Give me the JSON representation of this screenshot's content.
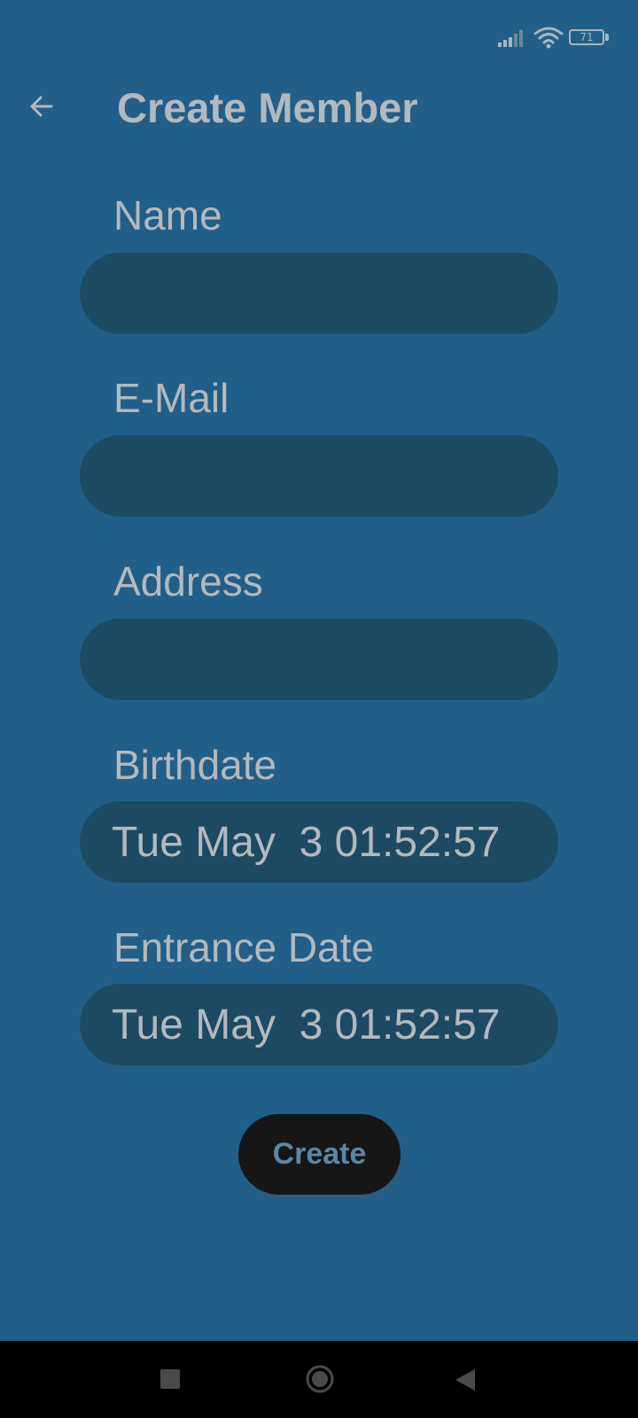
{
  "status_bar": {
    "battery_level": "71",
    "icons": [
      "signal-icon",
      "wifi-icon",
      "battery-icon"
    ]
  },
  "app_bar": {
    "title": "Create Member",
    "back_icon": "arrow-back-icon"
  },
  "form": {
    "name": {
      "label": "Name",
      "value": ""
    },
    "email": {
      "label": "E-Mail",
      "value": ""
    },
    "address": {
      "label": "Address",
      "value": ""
    },
    "birthdate": {
      "label": "Birthdate",
      "value": "Tue May  3 01:52:57"
    },
    "entrance_date": {
      "label": "Entrance Date",
      "value": "Tue May  3 01:52:57"
    },
    "submit_label": "Create"
  },
  "nav_bar": {
    "icons": [
      "recents-icon",
      "home-icon",
      "back-triangle-icon"
    ]
  },
  "colors": {
    "background": "#215f89",
    "input_background": "#1c4a62",
    "button_background": "#161616",
    "button_text": "#5b86a6",
    "text": "#b4b9bd"
  }
}
